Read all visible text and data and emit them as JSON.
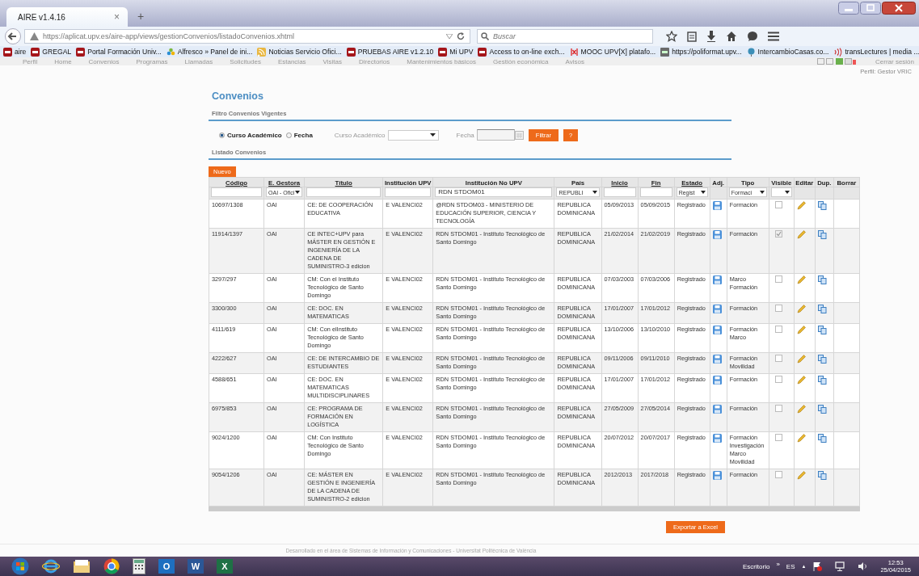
{
  "browser": {
    "tab_title": "AIRE v1.4.16",
    "tab_close": "×",
    "new_tab": "+",
    "url": "https://aplicat.upv.es/aire-app/views/gestionConvenios/listadoConvenios.xhtml",
    "search_placeholder": "Buscar",
    "bookmarks": [
      {
        "label": "aire",
        "kind": "upv"
      },
      {
        "label": "GREGAL",
        "kind": "upv"
      },
      {
        "label": "Portal Formación Univ...",
        "kind": "upv"
      },
      {
        "label": "Alfresco » Panel de ini...",
        "kind": "flower"
      },
      {
        "label": "Noticias Servicio Ofici...",
        "kind": "feed"
      },
      {
        "label": "PRUEBAS AIRE v1.2.10",
        "kind": "upv"
      },
      {
        "label": "Mi UPV",
        "kind": "upv"
      },
      {
        "label": "Access to on-line exch...",
        "kind": "upv"
      },
      {
        "label": "MOOC UPV[X] platafo...",
        "kind": "mooc"
      },
      {
        "label": "https://poliformat.upv...",
        "kind": "poli"
      },
      {
        "label": "IntercambioCasas.co...",
        "kind": "globe"
      },
      {
        "label": "transLectures | media ...",
        "kind": "waves"
      }
    ]
  },
  "menu": {
    "items": [
      "Perfil",
      "Home",
      "Convenios",
      "Programas",
      "Llamadas",
      "Solicitudes",
      "Estancias",
      "Visitas",
      "Directorios",
      "Mantenimientos básicos",
      "Gestión económica",
      "Avisos"
    ],
    "logout": "Cerrar sesión",
    "profile": "Perfil: Gestor VRIC"
  },
  "page": {
    "title": "Convenios",
    "filter_title": "Filtro Convenios Vigentes",
    "filter_options": [
      {
        "label": "Curso Académico",
        "selected": true
      },
      {
        "label": "Fecha",
        "selected": false
      }
    ],
    "course_label": "Curso Académico",
    "date_label": "Fecha",
    "filter_button": "Filtrar",
    "help_button": "?",
    "list_title": "Listado Convenios",
    "new_button": "Nuevo",
    "export_button": "Exportar a Excel"
  },
  "table": {
    "columns": [
      {
        "label": "Código",
        "sortable": true,
        "kind": "text"
      },
      {
        "label": "E. Gestora",
        "sortable": true,
        "kind": "select",
        "filter_value": "OAI - Ofici"
      },
      {
        "label": "Título",
        "sortable": true,
        "kind": "text"
      },
      {
        "label": "Institución UPV",
        "sortable": false,
        "kind": "text"
      },
      {
        "label": "Institución No UPV",
        "sortable": false,
        "kind": "text",
        "filter_value": "RDN STDOM01"
      },
      {
        "label": "País",
        "sortable": false,
        "kind": "select",
        "filter_value": "REPUBLI"
      },
      {
        "label": "Inicio",
        "sortable": true,
        "kind": "text"
      },
      {
        "label": "Fin",
        "sortable": true,
        "kind": "text"
      },
      {
        "label": "Estado",
        "sortable": true,
        "kind": "select",
        "filter_value": "Regist"
      },
      {
        "label": "Adj.",
        "sortable": false,
        "kind": "none"
      },
      {
        "label": "Tipo",
        "sortable": false,
        "kind": "select",
        "filter_value": "Formaci"
      },
      {
        "label": "Visible",
        "sortable": false,
        "kind": "select"
      },
      {
        "label": "Editar",
        "sortable": false,
        "kind": "none"
      },
      {
        "label": "Dup.",
        "sortable": false,
        "kind": "none"
      },
      {
        "label": "Borrar",
        "sortable": false,
        "kind": "none"
      }
    ],
    "rows": [
      {
        "codigo": "10697/1308",
        "gestora": "OAI",
        "titulo": "CE: DE COOPERACIÓN EDUCATIVA",
        "inst_upv": "E VALENCI02",
        "inst_no_upv": "@RDN STDOM03 - MINISTERIO DE EDUCACIÓN SUPERIOR, CIENCIA Y TECNOLOGÍA",
        "pais": "REPUBLICA DOMINICANA",
        "inicio": "05/09/2013",
        "fin": "05/09/2015",
        "estado": "Registrado",
        "tipo": "Formación",
        "visible": false
      },
      {
        "codigo": "11914/1397",
        "gestora": "OAI",
        "titulo": "CE INTEC+UPV para MÁSTER EN GESTIÓN E INGENIERÍA DE LA CADENA DE SUMINISTRO-3 edicion",
        "inst_upv": "E VALENCI02",
        "inst_no_upv": "RDN STDOM01 - Instituto Tecnológico de Santo Domingo",
        "pais": "REPUBLICA DOMINICANA",
        "inicio": "21/02/2014",
        "fin": "21/02/2019",
        "estado": "Registrado",
        "tipo": "Formación",
        "visible": true
      },
      {
        "codigo": "3297/297",
        "gestora": "OAI",
        "titulo": "CM: Con el Instituto Tecnológico de Santo Domingo",
        "inst_upv": "E VALENCI02",
        "inst_no_upv": "RDN STDOM01 - Instituto Tecnológico de Santo Domingo",
        "pais": "REPUBLICA DOMINICANA",
        "inicio": "07/03/2003",
        "fin": "07/03/2006",
        "estado": "Registrado",
        "tipo": "Marco\nFormación",
        "visible": false
      },
      {
        "codigo": "3300/300",
        "gestora": "OAI",
        "titulo": "CE: DOC. EN MATEMATICAS",
        "inst_upv": "E VALENCI02",
        "inst_no_upv": "RDN STDOM01 - Instituto Tecnológico de Santo Domingo",
        "pais": "REPUBLICA DOMINICANA",
        "inicio": "17/01/2007",
        "fin": "17/01/2012",
        "estado": "Registrado",
        "tipo": "Formación",
        "visible": false
      },
      {
        "codigo": "4111/619",
        "gestora": "OAI",
        "titulo": "CM: Con elInstituto Tecnológico de Santo Domingo",
        "inst_upv": "E VALENCI02",
        "inst_no_upv": "RDN STDOM01 - Instituto Tecnológico de Santo Domingo",
        "pais": "REPUBLICA DOMINICANA",
        "inicio": "13/10/2006",
        "fin": "13/10/2010",
        "estado": "Registrado",
        "tipo": "Formación\nMarco",
        "visible": false
      },
      {
        "codigo": "4222/627",
        "gestora": "OAI",
        "titulo": "CE: DE INTERCAMBIO DE ESTUDIANTES",
        "inst_upv": "E VALENCI02",
        "inst_no_upv": "RDN STDOM01 - Instituto Tecnológico de Santo Domingo",
        "pais": "REPUBLICA DOMINICANA",
        "inicio": "09/11/2006",
        "fin": "09/11/2010",
        "estado": "Registrado",
        "tipo": "Formación\nMovilidad",
        "visible": false
      },
      {
        "codigo": "4588/651",
        "gestora": "OAI",
        "titulo": "CE: DOC. EN MATEMATICAS MULTIDISCIPLINARES",
        "inst_upv": "E VALENCI02",
        "inst_no_upv": "RDN STDOM01 - Instituto Tecnológico de Santo Domingo",
        "pais": "REPUBLICA DOMINICANA",
        "inicio": "17/01/2007",
        "fin": "17/01/2012",
        "estado": "Registrado",
        "tipo": "Formación",
        "visible": false
      },
      {
        "codigo": "6975/853",
        "gestora": "OAI",
        "titulo": "CE: PROGRAMA DE FORMACIÓN EN LOGÍSTICA",
        "inst_upv": "E VALENCI02",
        "inst_no_upv": "RDN STDOM01 - Instituto Tecnológico de Santo Domingo",
        "pais": "REPUBLICA DOMINICANA",
        "inicio": "27/05/2009",
        "fin": "27/05/2014",
        "estado": "Registrado",
        "tipo": "Formación",
        "visible": false
      },
      {
        "codigo": "9024/1200",
        "gestora": "OAI",
        "titulo": "CM: Con Instituto Tecnológico de Santo Domingo",
        "inst_upv": "E VALENCI02",
        "inst_no_upv": "RDN STDOM01 - Instituto Tecnológico de Santo Domingo",
        "pais": "REPUBLICA DOMINICANA",
        "inicio": "20/07/2012",
        "fin": "20/07/2017",
        "estado": "Registrado",
        "tipo": "Formación\nInvestigación\nMarco\nMovilidad",
        "visible": false
      },
      {
        "codigo": "9054/1206",
        "gestora": "OAI",
        "titulo": "CE: MÁSTER EN GESTIÓN E INGENIERÍA DE LA CADENA DE SUMINISTRO-2 edicion",
        "inst_upv": "E VALENCI02",
        "inst_no_upv": "RDN STDOM01 - Instituto Tecnológico de Santo Domingo",
        "pais": "REPUBLICA DOMINICANA",
        "inicio": "2012/2013",
        "fin": "2017/2018",
        "estado": "Registrado",
        "tipo": "Formación",
        "visible": false
      }
    ]
  },
  "footer": "Desarrollado en el área de Sistemas de Información y Comunicaciones - Universitat Politècnica de València",
  "taskbar": {
    "apps": [
      {
        "kind": "start"
      },
      {
        "kind": "ie"
      },
      {
        "kind": "folder"
      },
      {
        "kind": "chrome"
      },
      {
        "kind": "calculator"
      },
      {
        "kind": "outlook",
        "letter": "O"
      },
      {
        "kind": "word",
        "letter": "W"
      },
      {
        "kind": "excel",
        "letter": "X"
      }
    ],
    "desktop": "Escritorio",
    "chevron": "»",
    "language": "ES",
    "tray_arrow": "▲",
    "time": "12:53",
    "date": "25/04/2015"
  }
}
